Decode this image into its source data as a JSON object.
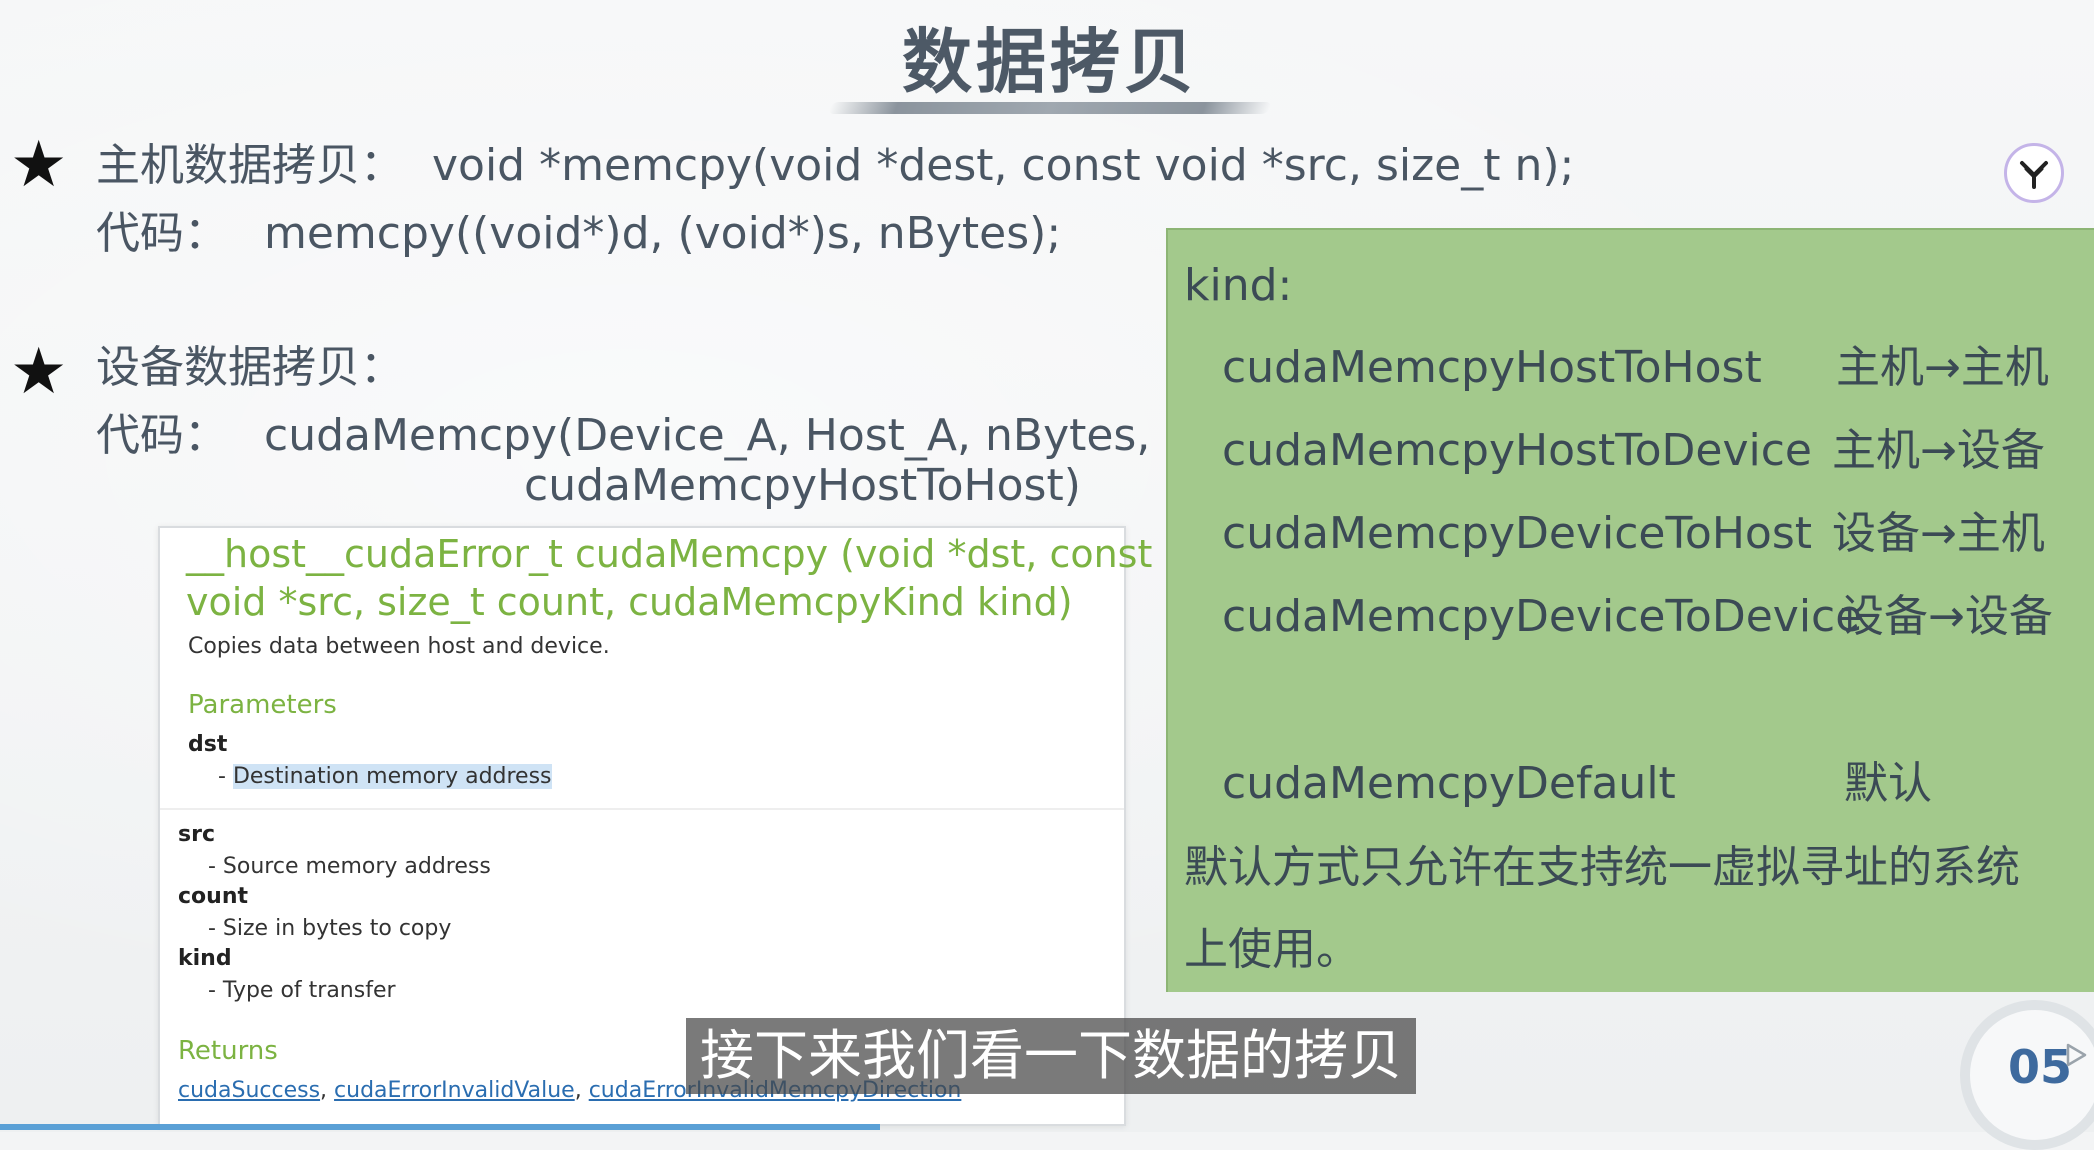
{
  "slide": {
    "title": "数据拷贝",
    "host_copy": {
      "label": "主机数据拷贝：",
      "signature": "void *memcpy(void *dest, const void *src, size_t n);",
      "code_label": "代码：",
      "code": "memcpy((void*)d, (void*)s, nBytes);"
    },
    "device_copy": {
      "label": "设备数据拷贝：",
      "code_label": "代码：",
      "code_line1": "cudaMemcpy(Device_A, Host_A, nBytes,",
      "code_line2": "cudaMemcpyHostToHost)"
    },
    "star_glyph": "★"
  },
  "kind_panel": {
    "heading": "kind:",
    "rows": [
      {
        "name": "cudaMemcpyHostToHost",
        "dir": "主机→主机"
      },
      {
        "name": "cudaMemcpyHostToDevice",
        "dir": "主机→设备"
      },
      {
        "name": "cudaMemcpyDeviceToHost",
        "dir": "设备→主机"
      },
      {
        "name": "cudaMemcpyDeviceToDevice",
        "dir": "设备→设备"
      }
    ],
    "default_name": "cudaMemcpyDefault",
    "default_dir": "默认",
    "note_line1": "默认方式只允许在支持统一虚拟寻址的系统",
    "note_line2": "上使用。"
  },
  "doc_panel": {
    "sig_line1": "__host__cudaError_t cudaMemcpy (void *dst, const",
    "sig_line2": "void *src, size_t count, cudaMemcpyKind kind)",
    "description": "Copies data between host and device.",
    "parameters_heading": "Parameters",
    "params": [
      {
        "name": "dst",
        "desc": "- ",
        "desc_hl": "Destination memory address"
      },
      {
        "name": "src",
        "desc": "- Source memory address"
      },
      {
        "name": "count",
        "desc": "- Size in bytes to copy"
      },
      {
        "name": "kind",
        "desc": "- Type of transfer"
      }
    ],
    "returns_heading": "Returns",
    "returns": [
      "cudaSuccess",
      "cudaErrorInvalidValue",
      "cudaErrorInvalidMemcpyDirection"
    ],
    "returns_sep": ", "
  },
  "overlay": {
    "subtitle": "接下来我们看一下数据的拷贝",
    "page_number": "05"
  },
  "colors": {
    "panel_green": "#a3c98c",
    "doc_green": "#7cb342",
    "link_blue": "#2a6db0",
    "progress_blue": "#5aa0d6"
  }
}
